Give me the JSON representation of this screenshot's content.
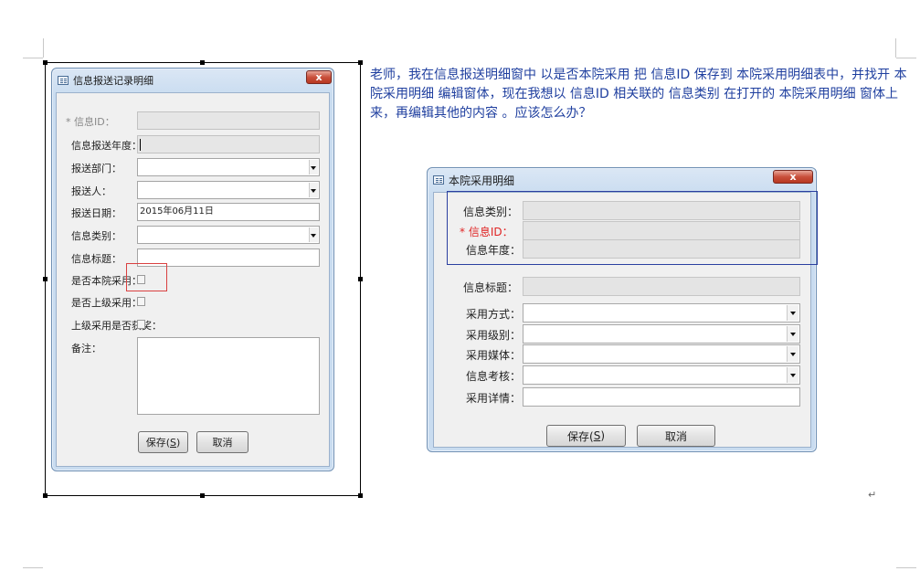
{
  "left_window": {
    "title": "信息报送记录明细",
    "close_label": "x",
    "fields": {
      "info_id": "* 信息ID：",
      "report_year": "信息报送年度：",
      "report_dept": "报送部门：",
      "reporter": "报送人：",
      "report_date": "报送日期：",
      "report_date_value": "2015年06月11日",
      "info_category": "信息类别：",
      "info_title": "信息标题：",
      "adopted_by_hospital": "是否本院采用：",
      "adopted_by_superior": "是否上级采用：",
      "superior_awarded": "上级采用是否获奖：",
      "remarks": "备注："
    },
    "save_label_prefix": "保存(",
    "save_label_key": "S",
    "save_label_suffix": ")",
    "cancel_label": "取消"
  },
  "question_text": "老师，我在信息报送明细窗中 以是否本院采用 把 信息ID 保存到 本院采用明细表中，并找开 本院采用明细 编辑窗体，现在我想以 信息ID 相关联的 信息类别 在打开的 本院采用明细 窗体上来，再编辑其他的内容 。应该怎么办？",
  "right_window": {
    "title": "本院采用明细",
    "close_label": "x",
    "fields": {
      "info_category": "信息类别：",
      "info_id_star": "* ",
      "info_id": "信息ID：",
      "info_year": "信息年度：",
      "info_title": "信息标题：",
      "adopt_method": "采用方式：",
      "adopt_level": "采用级别：",
      "adopt_media": "采用媒体：",
      "info_assessment": "信息考核：",
      "adopt_details": "采用详情："
    },
    "save_label_prefix": "保存(",
    "save_label_key": "S",
    "save_label_suffix": ")",
    "cancel_label": "取消"
  },
  "paragraph_mark": "↵",
  "colors": {
    "question_text": "#1f3f9f",
    "required_star": "#e02424",
    "highlight_box": "#d94040",
    "group_box": "#2b3fa0"
  }
}
